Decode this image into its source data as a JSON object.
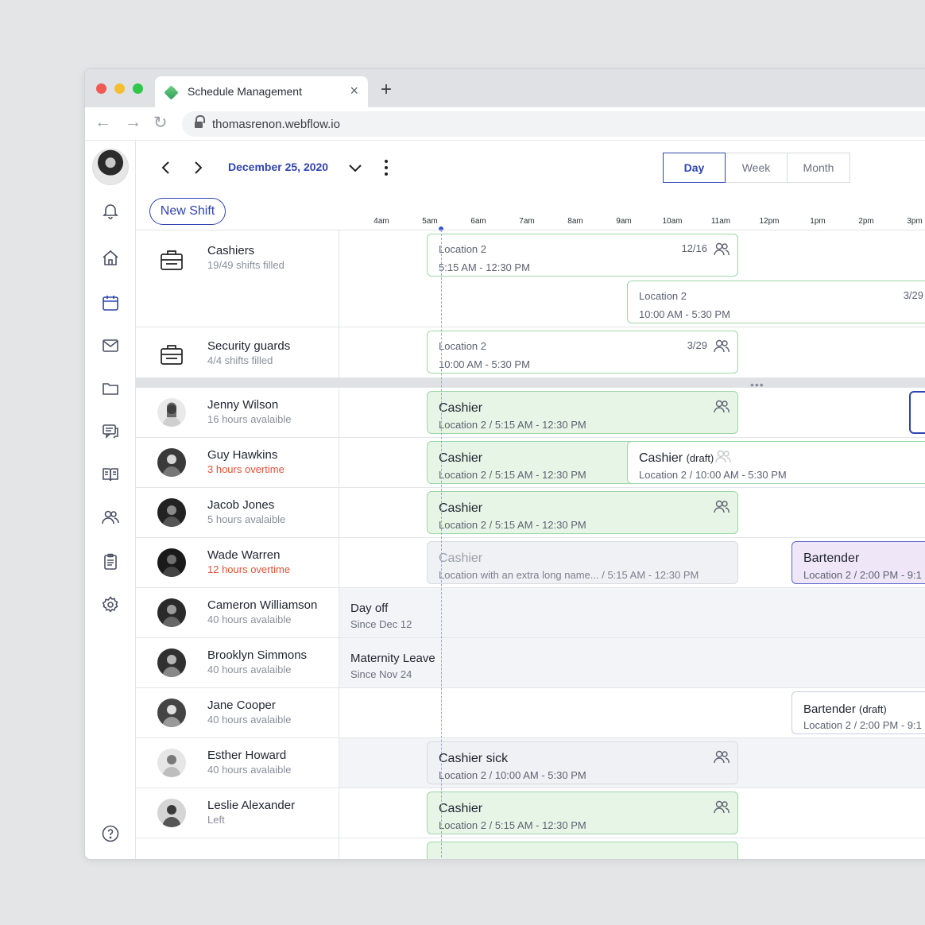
{
  "browser": {
    "tab_title": "Schedule Management",
    "close_glyph": "×",
    "new_tab_glyph": "+",
    "url": "thomasrenon.webflow.io",
    "back_glyph": "←",
    "forward_glyph": "→",
    "reload_glyph": "↻"
  },
  "toolbar": {
    "date": "December 25, 2020",
    "views": [
      "Day",
      "Week",
      "Month"
    ],
    "active_view": "Day",
    "new_shift_label": "New Shift"
  },
  "timeline": {
    "hours": [
      "4am",
      "5am",
      "6am",
      "7am",
      "8am",
      "9am",
      "10am",
      "11am",
      "12pm",
      "1pm",
      "2pm",
      "3pm"
    ]
  },
  "groups": [
    {
      "name": "Cashiers",
      "sub": "19/49 shifts filled",
      "shifts": [
        {
          "location": "Location 2",
          "time": "5:15 AM - 12:30 PM",
          "count": "12/16"
        },
        {
          "location": "Location 2",
          "time": "10:00 AM - 5:30 PM",
          "count": "3/29"
        }
      ]
    },
    {
      "name": "Security guards",
      "sub": "4/4 shifts filled",
      "shifts": [
        {
          "location": "Location 2",
          "time": "10:00 AM - 5:30 PM",
          "count": "3/29"
        }
      ]
    }
  ],
  "separator_glyph": "•••",
  "people": [
    {
      "name": "Jenny Wilson",
      "sub": "16 hours avalaible",
      "overtime": false,
      "shift": {
        "title": "Cashier",
        "detail": "Location 2 / 5:15 AM - 12:30 PM"
      }
    },
    {
      "name": "Guy Hawkins",
      "sub": "3 hours overtime",
      "overtime": true,
      "shift": {
        "title": "Cashier",
        "detail": "Location 2 / 5:15 AM - 12:30 PM"
      },
      "shift2": {
        "title": "Cashier",
        "draft": "(draft)",
        "detail": "Location 2 / 10:00 AM - 5:30 PM"
      }
    },
    {
      "name": "Jacob Jones",
      "sub": "5 hours avalaible",
      "overtime": false,
      "shift": {
        "title": "Cashier",
        "detail": "Location 2 / 5:15 AM - 12:30 PM"
      }
    },
    {
      "name": "Wade Warren",
      "sub": "12 hours overtime",
      "overtime": true,
      "shift": {
        "title": "Cashier",
        "detail": "Location with an extra long name... / 5:15 AM - 12:30 PM"
      },
      "shift2": {
        "title": "Bartender",
        "detail": "Location 2 / 2:00 PM - 9:1"
      }
    },
    {
      "name": "Cameron Williamson",
      "sub": "40 hours avalaible",
      "overtime": false,
      "status": {
        "title": "Day off",
        "since": "Since Dec 12"
      }
    },
    {
      "name": "Brooklyn Simmons",
      "sub": "40 hours avalaible",
      "overtime": false,
      "status": {
        "title": "Maternity Leave",
        "since": "Since Nov 24"
      }
    },
    {
      "name": "Jane Cooper",
      "sub": "40 hours avalaible",
      "overtime": false,
      "shift2": {
        "title": "Bartender",
        "draft": "(draft)",
        "detail": "Location 2 / 2:00 PM - 9:1"
      }
    },
    {
      "name": "Esther Howard",
      "sub": "40 hours avalaible",
      "overtime": false,
      "shift": {
        "title": "Cashier sick",
        "detail": "Location 2 / 10:00 AM - 5:30 PM"
      }
    },
    {
      "name": "Leslie Alexander",
      "sub": "Left",
      "overtime": false,
      "shift": {
        "title": "Cashier",
        "detail": "Location 2 / 5:15 AM - 12:30 PM"
      }
    }
  ],
  "colors": {
    "accent": "#2f44b0",
    "shift_green": "#e7f5e6",
    "shift_border": "#9ed6a7",
    "overtime": "#e25234",
    "bartender": "#efe7f7"
  },
  "icons": [
    "bell-icon",
    "home-icon",
    "calendar-icon",
    "mail-icon",
    "folder-icon",
    "chat-icon",
    "book-icon",
    "users-icon",
    "clipboard-icon",
    "settings-icon",
    "help-icon",
    "briefcase-icon",
    "people-icon"
  ]
}
